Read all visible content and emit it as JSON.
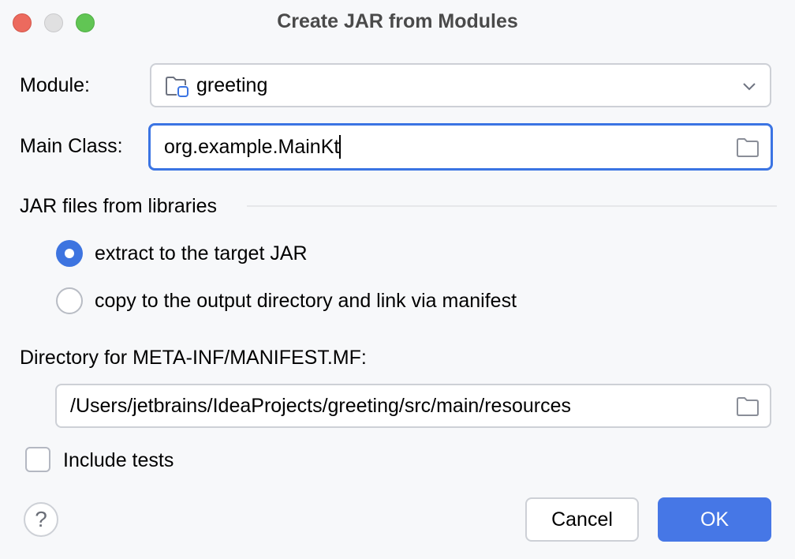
{
  "window": {
    "title": "Create JAR from Modules"
  },
  "form": {
    "module_label": "Module:",
    "module_value": "greeting",
    "main_class_label": "Main Class:",
    "main_class_value": "org.example.MainKt",
    "libraries_section_title": "JAR files from libraries",
    "library_options": [
      {
        "label": "extract to the target JAR",
        "selected": true
      },
      {
        "label": "copy to the output directory and link via manifest",
        "selected": false
      }
    ],
    "manifest_dir_label": "Directory for META-INF/MANIFEST.MF:",
    "manifest_dir_value": "/Users/jetbrains/IdeaProjects/greeting/src/main/resources",
    "include_tests_label": "Include tests",
    "include_tests_checked": false
  },
  "buttons": {
    "help": "?",
    "cancel": "Cancel",
    "ok": "OK"
  },
  "colors": {
    "accent": "#4677e6",
    "focus_border": "#3b74e3",
    "background": "#f7f8fa"
  }
}
